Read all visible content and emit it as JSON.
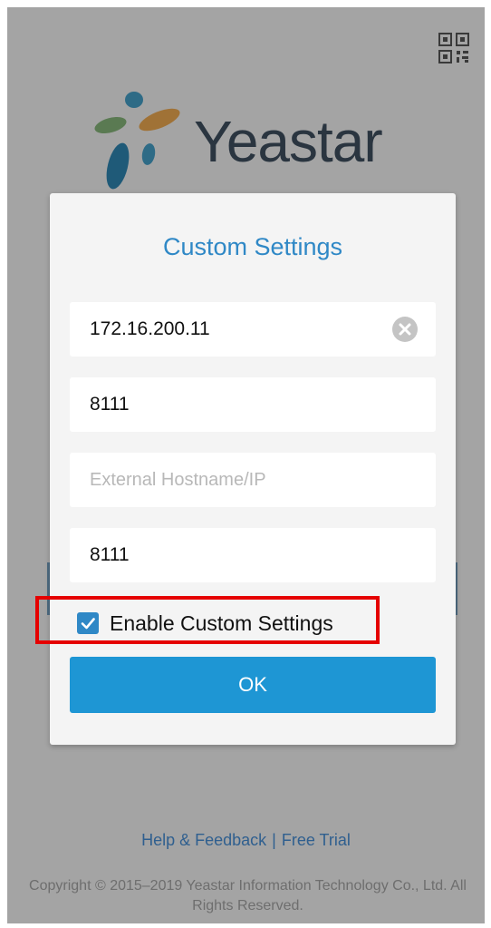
{
  "header": {
    "qr_icon": "qr-code-icon"
  },
  "logo": {
    "brand": "Yeastar"
  },
  "dialog": {
    "title": "Custom Settings",
    "fields": {
      "server_ip": {
        "value": "172.16.200.11",
        "clear_icon": "clear-icon"
      },
      "port": {
        "value": "8111"
      },
      "external_host": {
        "value": "",
        "placeholder": "External Hostname/IP"
      },
      "external_port": {
        "value": "8111"
      }
    },
    "enable_custom": {
      "label": "Enable Custom Settings",
      "checked": true
    },
    "ok_label": "OK"
  },
  "footer": {
    "help_link": "Help & Feedback",
    "separator": "|",
    "trial_link": "Free Trial",
    "copyright": "Copyright © 2015–2019 Yeastar Information Technology Co., Ltd. All Rights Reserved."
  },
  "colors": {
    "accent": "#2f88c6",
    "button": "#1e96d4",
    "highlight": "#e50000",
    "overlay": "#a4a4a4"
  }
}
